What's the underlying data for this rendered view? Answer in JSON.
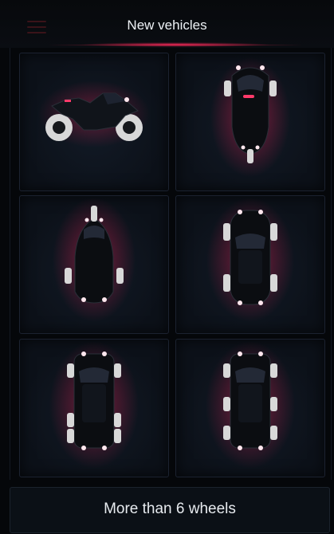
{
  "header": {
    "title": "New vehicles"
  },
  "vehicles": [
    {
      "id": "motorcycle"
    },
    {
      "id": "three-wheeler-reverse"
    },
    {
      "id": "three-wheeler"
    },
    {
      "id": "four-wheel-car"
    },
    {
      "id": "six-wheel-vehicle"
    },
    {
      "id": "six-wheel-alt-vehicle"
    }
  ],
  "footer": {
    "more_label": "More than 6 wheels"
  },
  "colors": {
    "glow": "#ff1e56",
    "accent": "#ff3a6a",
    "background": "#05070a"
  }
}
